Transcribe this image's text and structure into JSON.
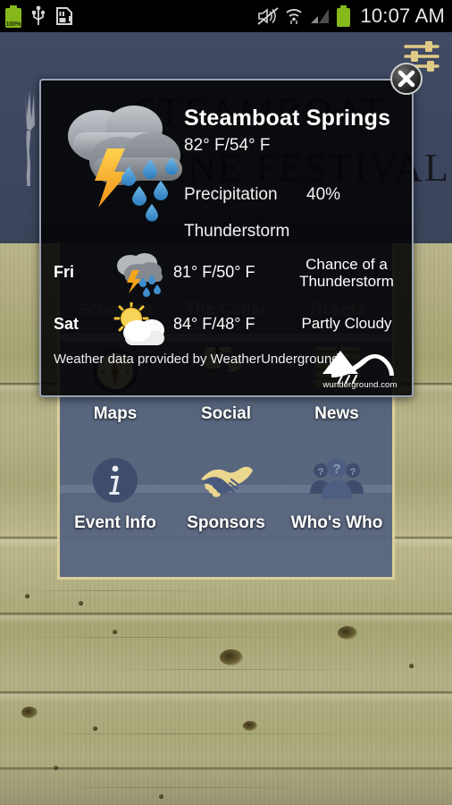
{
  "statusbar": {
    "battery_percent": "100%",
    "time": "10:07 AM",
    "icons_left": [
      "battery-icon",
      "usb-icon",
      "sd-card-icon"
    ],
    "icons_right": [
      "mute-icon",
      "wifi-icon",
      "signal-icon",
      "battery-icon"
    ]
  },
  "app": {
    "background_title_line1": "STEAMBOAT",
    "background_title_line2": "WINE FESTIVAL",
    "settings_icon": "sliders-icon",
    "close_icon": "close-x-icon"
  },
  "weather_dialog": {
    "city": "Steamboat Springs",
    "temperature": "82° F/54° F",
    "condition_icon": "thunderstorm-icon",
    "precipitation_label": "Precipitation",
    "precipitation_value": "40%",
    "condition": "Thunderstorm",
    "forecast": [
      {
        "day": "Fri",
        "icon": "thunderstorm-icon",
        "temperature": "81° F/50° F",
        "description": "Chance of a Thunderstorm"
      },
      {
        "day": "Sat",
        "icon": "partly-cloudy-icon",
        "temperature": "84° F/48° F",
        "description": "Partly Cloudy"
      }
    ],
    "attribution": "Weather data provided by WeatherUnderground.",
    "logo_text": "wunderground.com"
  },
  "menu": {
    "hidden_row_labels": [
      "Schedule",
      "The Cellar",
      "Tickets"
    ],
    "rows": [
      [
        {
          "label": "Maps",
          "icon": "compass-icon"
        },
        {
          "label": "Social",
          "icon": "social-bubbles-icon"
        },
        {
          "label": "News",
          "icon": "newspaper-icon"
        }
      ],
      [
        {
          "label": "Event Info",
          "icon": "info-circle-icon"
        },
        {
          "label": "Sponsors",
          "icon": "handshake-icon"
        },
        {
          "label": "Who's Who",
          "icon": "people-question-icon"
        }
      ]
    ]
  },
  "colors": {
    "status_bar_bg": "#000000",
    "app_bg": "#3c465e",
    "menu_panel": "#566480",
    "menu_border": "#d9cf9a",
    "accent_gold": "#e0cb86",
    "battery_green": "#86b81c",
    "dialog_bg": "#040406",
    "dialog_border": "#9aa2b4",
    "wood": "#b3b184"
  }
}
